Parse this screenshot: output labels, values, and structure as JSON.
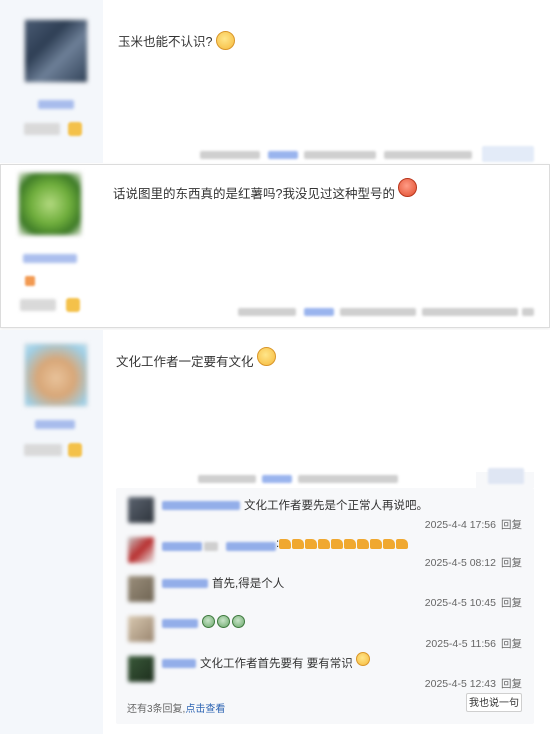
{
  "posts": [
    {
      "text": "玉米也能不认识?"
    },
    {
      "text": "话说图里的东西真的是红薯吗?我没见过这种型号的"
    },
    {
      "text": "文化工作者一定要有文化"
    }
  ],
  "replies": [
    {
      "text": "文化工作者要先是个正常人再说吧。",
      "time": "2025-4-4 17:56",
      "reply": "回复"
    },
    {
      "text": ":",
      "time": "2025-4-5 08:12",
      "reply": "回复",
      "thumbs": 10
    },
    {
      "text": "首先,得是个人",
      "time": "2025-4-5 10:45",
      "reply": "回复"
    },
    {
      "text": "",
      "time": "2025-4-5 11:56",
      "reply": "回复",
      "cry": 3
    },
    {
      "text": "文化工作者首先要有 要有常识",
      "time": "2025-4-5 12:43",
      "reply": "回复"
    }
  ],
  "more": {
    "prefix": "还有3条回复,",
    "link": "点击查看"
  },
  "say_button": "我也说一句",
  "icons": {
    "emoji_yellow": "laughing-face",
    "emoji_red": "angry-face",
    "thumb": "thumbs-up",
    "cry": "crying-face"
  }
}
